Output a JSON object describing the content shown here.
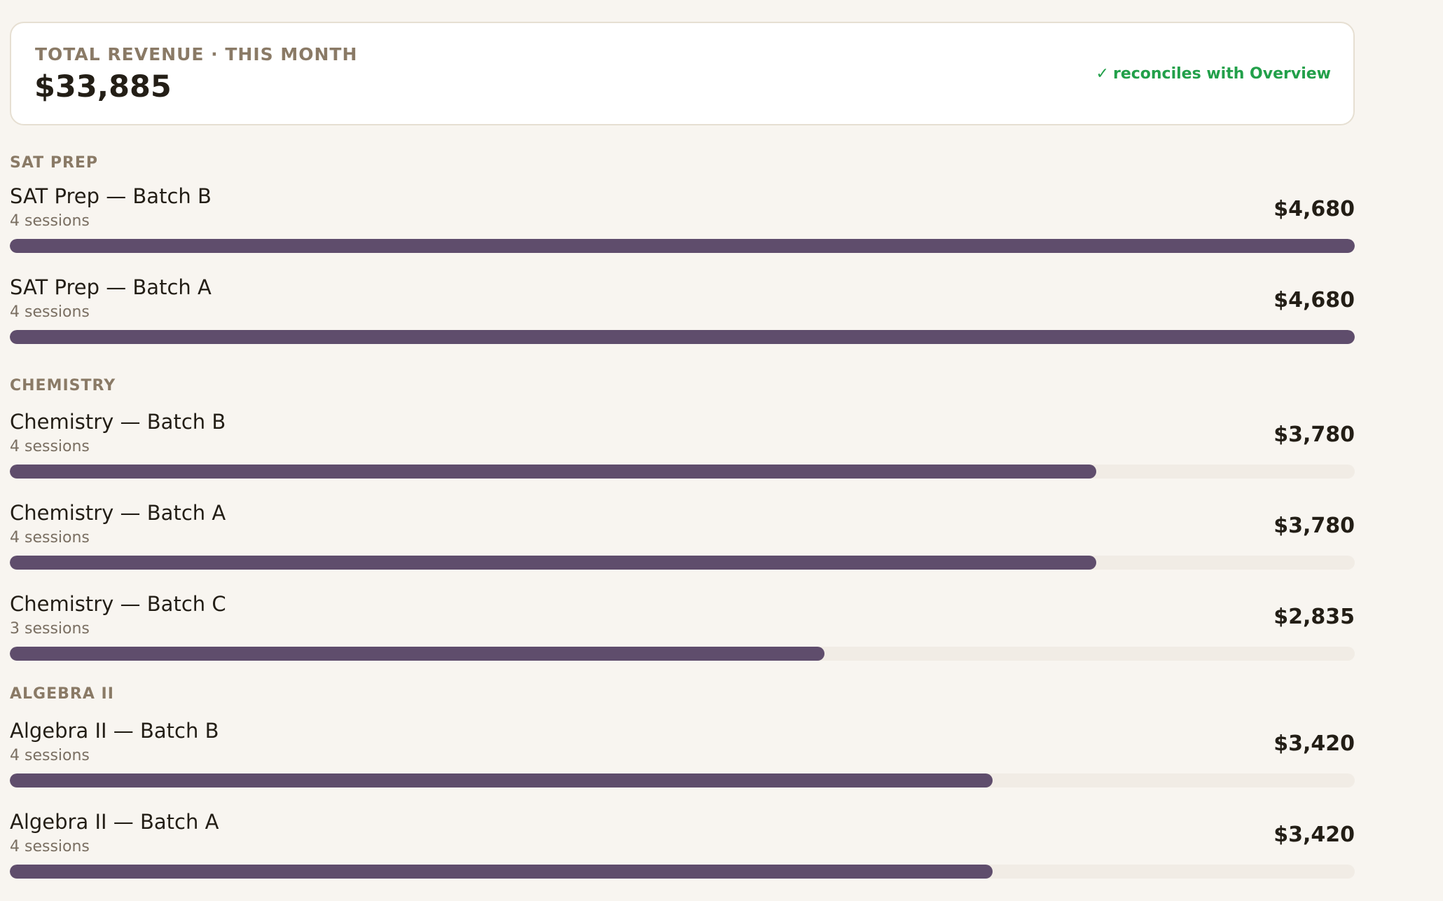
{
  "summary": {
    "label": "TOTAL REVENUE · THIS MONTH",
    "value": "$33,885",
    "reconcile_icon": "✓",
    "reconcile_text": "reconciles with Overview",
    "reconcile_color": "#22a04a"
  },
  "bar_color": "#5f4d6c",
  "max_amount": 4680,
  "groups": [
    {
      "label": "SAT PREP",
      "rows": [
        {
          "title": "SAT Prep — Batch B",
          "sessions": "4 sessions",
          "amount": "$4,680",
          "value": 4680
        },
        {
          "title": "SAT Prep — Batch A",
          "sessions": "4 sessions",
          "amount": "$4,680",
          "value": 4680
        }
      ]
    },
    {
      "label": "CHEMISTRY",
      "rows": [
        {
          "title": "Chemistry — Batch B",
          "sessions": "4 sessions",
          "amount": "$3,780",
          "value": 3780
        },
        {
          "title": "Chemistry — Batch A",
          "sessions": "4 sessions",
          "amount": "$3,780",
          "value": 3780
        },
        {
          "title": "Chemistry — Batch C",
          "sessions": "3 sessions",
          "amount": "$2,835",
          "value": 2835
        }
      ]
    },
    {
      "label": "ALGEBRA II",
      "rows": [
        {
          "title": "Algebra II — Batch B",
          "sessions": "4 sessions",
          "amount": "$3,420",
          "value": 3420
        },
        {
          "title": "Algebra II — Batch A",
          "sessions": "4 sessions",
          "amount": "$3,420",
          "value": 3420
        }
      ]
    }
  ]
}
